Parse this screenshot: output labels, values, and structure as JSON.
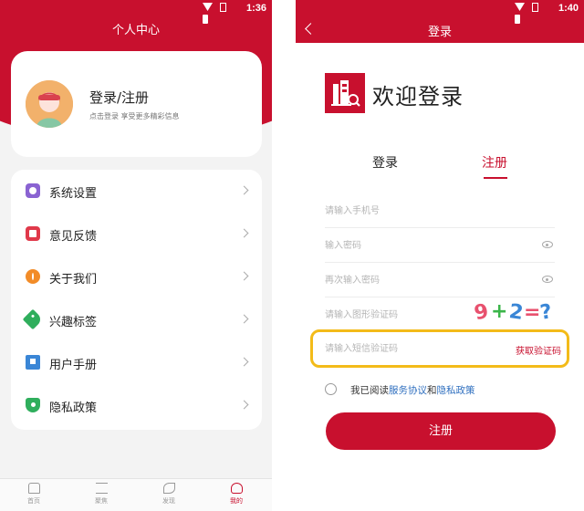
{
  "left": {
    "status": {
      "time": "1:36"
    },
    "title": "个人中心",
    "profile": {
      "name": "登录/注册",
      "subtitle": "点击登录 享受更多精彩信息"
    },
    "menu": [
      {
        "label": "系统设置",
        "icon": "settings-icon",
        "color": "#8a63d2"
      },
      {
        "label": "意见反馈",
        "icon": "feedback-icon",
        "color": "#e0394a"
      },
      {
        "label": "关于我们",
        "icon": "info-icon",
        "color": "#f28c28"
      },
      {
        "label": "兴趣标签",
        "icon": "tag-icon",
        "color": "#2fae5c"
      },
      {
        "label": "用户手册",
        "icon": "manual-icon",
        "color": "#3a86d6"
      },
      {
        "label": "隐私政策",
        "icon": "shield-icon",
        "color": "#2fae5c"
      }
    ],
    "tabs": [
      {
        "label": "首页",
        "icon": "home-icon",
        "active": false
      },
      {
        "label": "聚焦",
        "icon": "list-icon",
        "active": false
      },
      {
        "label": "发现",
        "icon": "feather-icon",
        "active": false
      },
      {
        "label": "我的",
        "icon": "user-icon",
        "active": true
      }
    ]
  },
  "right": {
    "status": {
      "time": "1:40"
    },
    "title": "登录",
    "welcome": "欢迎登录",
    "tabs": {
      "login": "登录",
      "register": "注册"
    },
    "fields": {
      "phone_placeholder": "请输入手机号",
      "password_placeholder": "输入密码",
      "confirm_placeholder": "再次输入密码",
      "captcha_placeholder": "请输入图形验证码",
      "sms_placeholder": "请输入短信验证码"
    },
    "captcha_chars": [
      "9",
      "+",
      "2",
      "=",
      "?"
    ],
    "sms_link": "获取验证码",
    "agree": {
      "prefix": "我已阅读",
      "terms": "服务协议",
      "and": "和",
      "privacy": "隐私政策"
    },
    "register_button": "注册"
  },
  "colors": {
    "brand_red": "#c8102e",
    "highlight": "#f3bb19",
    "link_blue": "#2f6fbf"
  }
}
